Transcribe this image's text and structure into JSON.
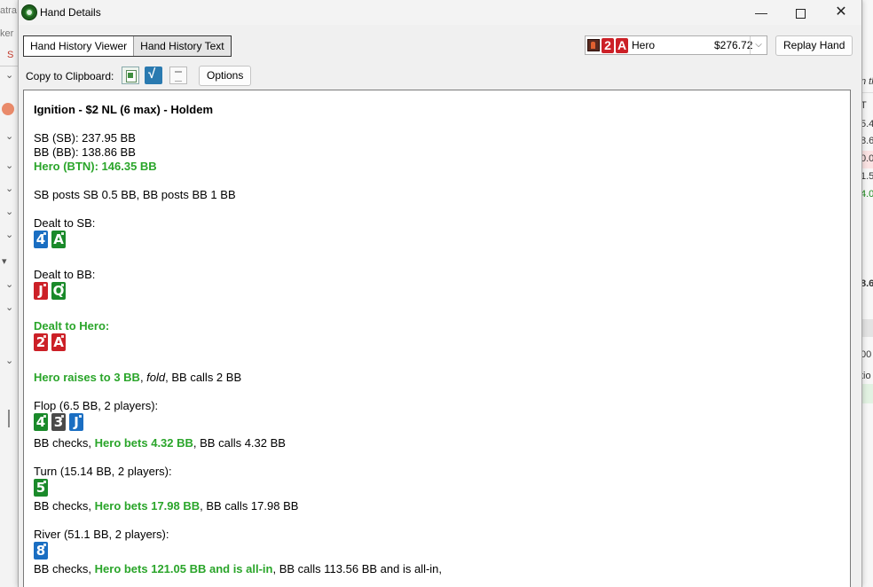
{
  "window": {
    "title": "Hand Details",
    "controls": {
      "minimize": "—",
      "maximize": "",
      "close": "✕"
    }
  },
  "toolbar": {
    "tabs": [
      {
        "label": "Hand History Viewer",
        "active": false
      },
      {
        "label": "Hand History Text",
        "active": true
      }
    ],
    "player": {
      "cards": [
        "2",
        "A"
      ],
      "name": "Hero",
      "amount": "$276.72"
    },
    "replay_label": "Replay Hand",
    "copy_label": "Copy to Clipboard:",
    "options_label": "Options"
  },
  "hand": {
    "header": "Ignition - $2 NL (6 max) - Holdem",
    "stacks": [
      "SB (SB): 237.95 BB",
      "BB (BB): 138.86 BB"
    ],
    "hero_stack": "Hero (BTN): 146.35 BB",
    "posts": "SB posts SB 0.5 BB, BB posts BB 1 BB",
    "dealt_sb": {
      "label": "Dealt to SB:",
      "cards": [
        {
          "rank": "4",
          "suit": "d"
        },
        {
          "rank": "A",
          "suit": "c"
        }
      ]
    },
    "dealt_bb": {
      "label": "Dealt to BB:",
      "cards": [
        {
          "rank": "J",
          "suit": "h"
        },
        {
          "rank": "Q",
          "suit": "c"
        }
      ]
    },
    "dealt_hero": {
      "label": "Dealt to Hero:",
      "cards": [
        {
          "rank": "2",
          "suit": "h"
        },
        {
          "rank": "A",
          "suit": "h"
        }
      ]
    },
    "preflop": {
      "hero": "Hero raises to 3 BB",
      "sep1": ", ",
      "fold": "fold",
      "rest": ", BB calls 2 BB"
    },
    "flop": {
      "label": "Flop (6.5 BB, 2 players):",
      "cards": [
        {
          "rank": "4",
          "suit": "c"
        },
        {
          "rank": "3",
          "suit": "s"
        },
        {
          "rank": "J",
          "suit": "d"
        }
      ],
      "pre": "BB checks, ",
      "hero": "Hero bets 4.32 BB",
      "post": ", BB calls 4.32 BB"
    },
    "turn": {
      "label": "Turn (15.14 BB, 2 players):",
      "cards": [
        {
          "rank": "5",
          "suit": "c"
        }
      ],
      "pre": "BB checks, ",
      "hero": "Hero bets 17.98 BB",
      "post": ", BB calls 17.98 BB"
    },
    "river": {
      "label": "River (51.1 BB, 2 players):",
      "cards": [
        {
          "rank": "8",
          "suit": "d"
        }
      ],
      "pre": "BB checks, ",
      "hero": "Hero bets 121.05 BB and is all-in",
      "post": ", BB calls 113.56 BB and is all-in,"
    }
  },
  "background": {
    "left_texts": [
      "atra",
      "ker",
      "S"
    ],
    "right_texts": [
      "n th",
      "T",
      "5.4",
      "8.6",
      "0.0",
      "1.5",
      "4.0",
      "8.6",
      "00 H",
      "tio"
    ]
  },
  "colors": {
    "hero_green": "#2aa52a",
    "club": "#1a8a2a",
    "diamond": "#1a6ec2",
    "heart": "#cc2027",
    "spade": "#4a4a4a"
  }
}
